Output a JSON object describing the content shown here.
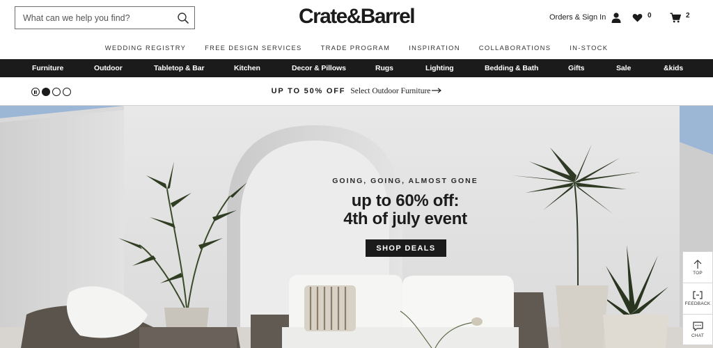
{
  "header": {
    "search_placeholder": "What can we help you find?",
    "logo": "Crate&Barrel",
    "sign_in_label": "Orders & Sign In",
    "favorites_count": "0",
    "cart_count": "2",
    "icons": [
      "search-icon",
      "user-icon",
      "heart-icon",
      "cart-icon"
    ]
  },
  "secondary_nav": [
    "WEDDING REGISTRY",
    "FREE DESIGN SERVICES",
    "TRADE PROGRAM",
    "INSPIRATION",
    "COLLABORATIONS",
    "IN-STOCK"
  ],
  "main_nav": [
    "Furniture",
    "Outdoor",
    "Tabletop & Bar",
    "Kitchen",
    "Decor & Pillows",
    "Rugs",
    "Lighting",
    "Bedding & Bath",
    "Gifts",
    "Sale",
    "&kids"
  ],
  "promo": {
    "headline": "UP TO 50% OFF",
    "link": "Select Outdoor Furniture",
    "slides": 3,
    "active_slide": 1
  },
  "hero": {
    "eyebrow": "GOING, GOING, ALMOST GONE",
    "title_line1": "up to 60% off:",
    "title_line2": "4th of july event",
    "cta": "SHOP DEALS"
  },
  "side_tools": {
    "top": "TOP",
    "feedback": "FEEDBACK",
    "chat": "CHAT"
  },
  "colors": {
    "nav_bg": "#1b1b1b",
    "text": "#1b1b1b",
    "sky": "#9cb6d6"
  }
}
